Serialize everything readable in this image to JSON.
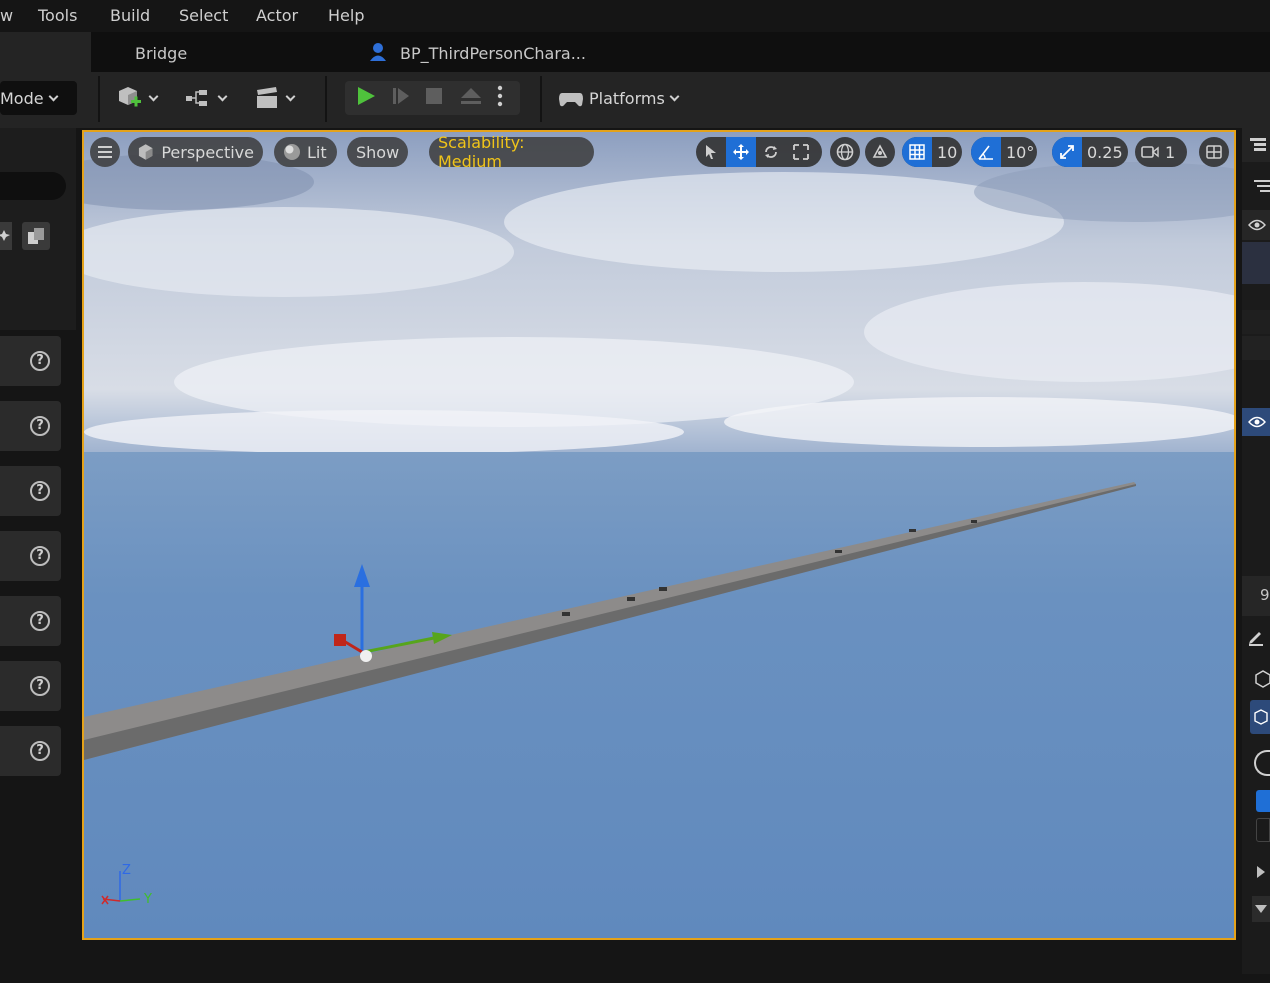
{
  "menubar": {
    "items": [
      "w",
      "Tools",
      "Build",
      "Select",
      "Actor",
      "Help"
    ]
  },
  "tabs": {
    "bridge": "Bridge",
    "blueprint": "BP_ThirdPersonChara..."
  },
  "toolbar": {
    "mode_label": "Mode",
    "platforms_label": "Platforms"
  },
  "viewport": {
    "perspective_label": "Perspective",
    "lit_label": "Lit",
    "show_label": "Show",
    "scalability_label": "Scalability: Medium",
    "grid_snap_value": "10",
    "rotation_snap_value": "10°",
    "scale_snap_value": "0.25",
    "camera_speed_value": "1",
    "axis_z": "Z",
    "axis_y": "Y"
  },
  "right_panel": {
    "partial_value": "9"
  },
  "colors": {
    "accent_blue": "#1f6fd6",
    "viewport_border": "#e4a21a",
    "scalability_text": "#f0c419",
    "play_green": "#4fc23c"
  }
}
